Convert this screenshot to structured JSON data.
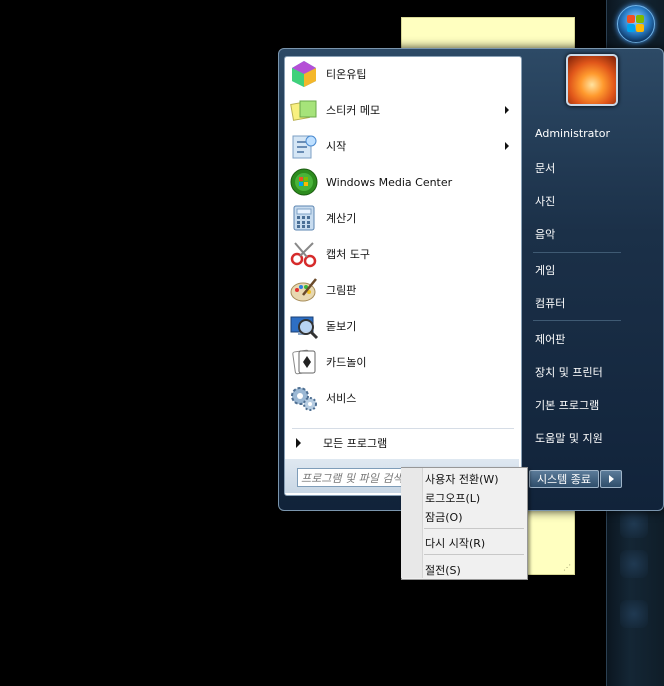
{
  "start_menu": {
    "programs": [
      {
        "label": "티온유팁",
        "icon": "colorful-cube-icon",
        "has_submenu": false
      },
      {
        "label": "스티커 메모",
        "icon": "sticky-notes-icon",
        "has_submenu": true
      },
      {
        "label": "시작",
        "icon": "getting-started-icon",
        "has_submenu": true
      },
      {
        "label": "Windows Media Center",
        "icon": "media-center-icon",
        "has_submenu": false
      },
      {
        "label": "계산기",
        "icon": "calculator-icon",
        "has_submenu": false
      },
      {
        "label": "캡처 도구",
        "icon": "snipping-tool-icon",
        "has_submenu": false
      },
      {
        "label": "그림판",
        "icon": "paint-icon",
        "has_submenu": false
      },
      {
        "label": "돋보기",
        "icon": "magnifier-icon",
        "has_submenu": false
      },
      {
        "label": "카드놀이",
        "icon": "solitaire-icon",
        "has_submenu": false
      },
      {
        "label": "서비스",
        "icon": "services-icon",
        "has_submenu": false
      }
    ],
    "all_programs_label": "모든 프로그램",
    "search_placeholder": "프로그램 및 파일 검색",
    "right_links": [
      {
        "label": "Administrator"
      },
      {
        "label": "문서"
      },
      {
        "label": "사진"
      },
      {
        "label": "음악"
      },
      {
        "label": "게임"
      },
      {
        "label": "컴퓨터"
      },
      {
        "label": "제어판"
      },
      {
        "label": "장치 및 프린터"
      },
      {
        "label": "기본 프로그램"
      },
      {
        "label": "도움말 및 지원"
      }
    ],
    "shutdown_label": "시스템 종료"
  },
  "shutdown_menu": {
    "items": [
      {
        "label": "사용자 전환(W)"
      },
      {
        "label": "로그오프(L)"
      },
      {
        "label": "잠금(O)"
      },
      {
        "label": "다시 시작(R)"
      },
      {
        "label": "절전(S)"
      }
    ]
  },
  "colors": {
    "menu_frame": "#1b3048",
    "left_pane": "#ffffff",
    "sticky_note": "#ffffc0",
    "desktop": "#000000"
  }
}
